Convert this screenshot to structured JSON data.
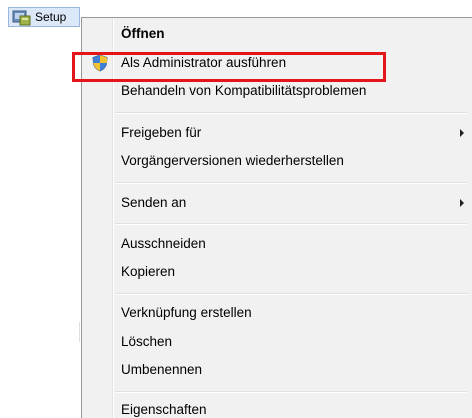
{
  "desktop": {
    "file_label": "Setup",
    "file_icon": "setup-installer-icon"
  },
  "context_menu": {
    "groups": [
      {
        "items": [
          {
            "label": "Öffnen",
            "bold": true
          },
          {
            "label": "Als Administrator ausführen",
            "icon": "uac-shield-icon",
            "highlighted": true
          },
          {
            "label": "Behandeln von Kompatibilitätsproblemen"
          }
        ]
      },
      {
        "items": [
          {
            "label": "Freigeben für",
            "submenu": true
          },
          {
            "label": "Vorgängerversionen wiederherstellen"
          }
        ]
      },
      {
        "items": [
          {
            "label": "Senden an",
            "submenu": true
          }
        ]
      },
      {
        "items": [
          {
            "label": "Ausschneiden"
          },
          {
            "label": "Kopieren"
          }
        ]
      },
      {
        "items": [
          {
            "label": "Verknüpfung erstellen"
          },
          {
            "label": "Löschen"
          },
          {
            "label": "Umbenennen"
          }
        ]
      },
      {
        "items": [
          {
            "label": "Eigenschaften"
          }
        ]
      }
    ]
  },
  "annotation": {
    "highlight_color": "#e3141a"
  }
}
